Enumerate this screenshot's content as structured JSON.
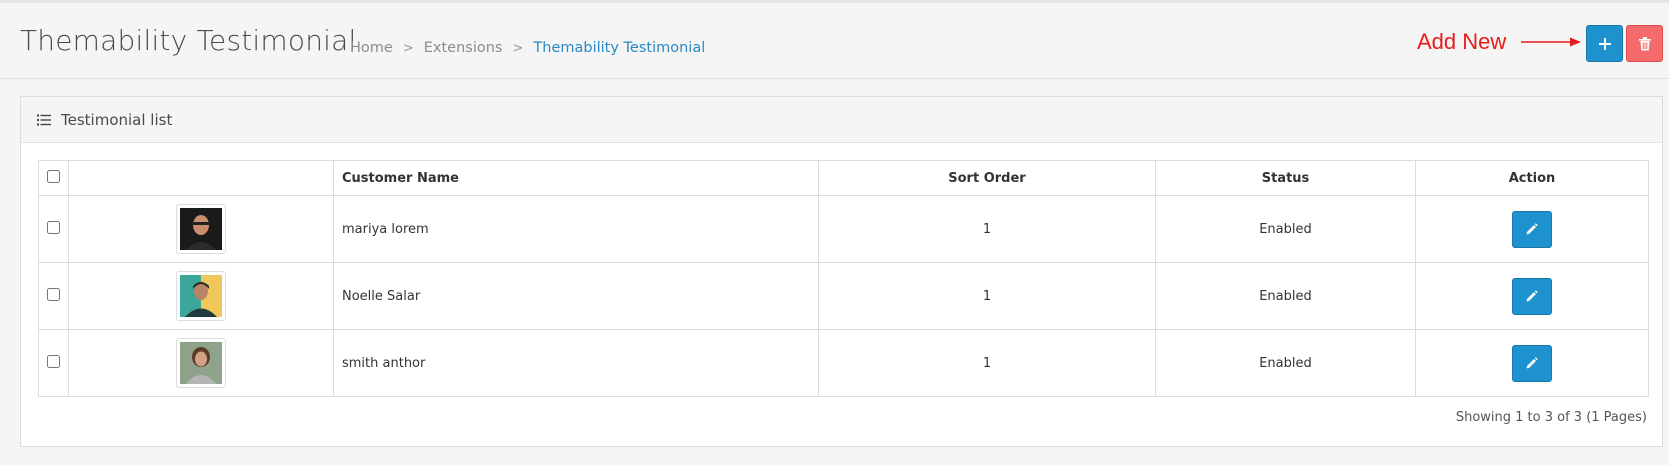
{
  "header": {
    "title": "Themability Testimonial",
    "breadcrumb": [
      "Home",
      "Extensions",
      "Themability Testimonial"
    ],
    "annotation": "Add New",
    "add_button_icon": "plus-icon",
    "delete_button_icon": "trash-icon"
  },
  "panel": {
    "title": "Testimonial list",
    "icon": "list-icon"
  },
  "table": {
    "columns": [
      "",
      "",
      "Customer Name",
      "Sort Order",
      "Status",
      "Action"
    ],
    "rows": [
      {
        "name": "mariya lorem",
        "sort_order": "1",
        "status": "Enabled"
      },
      {
        "name": "Noelle Salar",
        "sort_order": "1",
        "status": "Enabled"
      },
      {
        "name": "smith anthor",
        "sort_order": "1",
        "status": "Enabled"
      }
    ]
  },
  "pagination": {
    "summary": "Showing 1 to 3 of 3 (1 Pages)"
  },
  "colors": {
    "primary": "#1e91cf",
    "danger": "#f56b6b",
    "annotation": "#e81b1b",
    "breadcrumb_active": "#2b8ac4"
  }
}
